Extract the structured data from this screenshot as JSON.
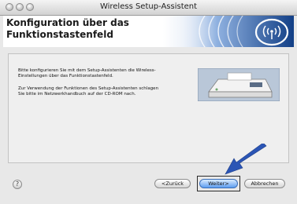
{
  "window": {
    "title": "Wireless Setup-Assistent"
  },
  "header": {
    "line1": "Konfiguration über das",
    "line2": "Funktionstastenfeld"
  },
  "content": {
    "paragraph1_line1": "Bitte konfigurieren Sie mit dem Setup-Assistenten die Wireless-",
    "paragraph1_line2": "Einstellungen über das Funktionstastenfeld.",
    "paragraph2_line1": "Zur Verwendung der Funktionen des Setup-Assistenten schlagen",
    "paragraph2_line2": "Sie bitte im Netzwerkhandbuch auf der CD-ROM nach."
  },
  "footer": {
    "help": "?",
    "back": "<Zurück",
    "next": "Weiter>",
    "cancel": "Abbrechen"
  },
  "colors": {
    "accent": "#1d4f9c",
    "arrow": "#2b55b5",
    "default_button": "#5d9df0"
  },
  "icons": [
    "close-icon",
    "minimize-icon",
    "zoom-icon",
    "wireless-logo-icon",
    "printer-image",
    "pointer-arrow-icon",
    "help-icon"
  ]
}
